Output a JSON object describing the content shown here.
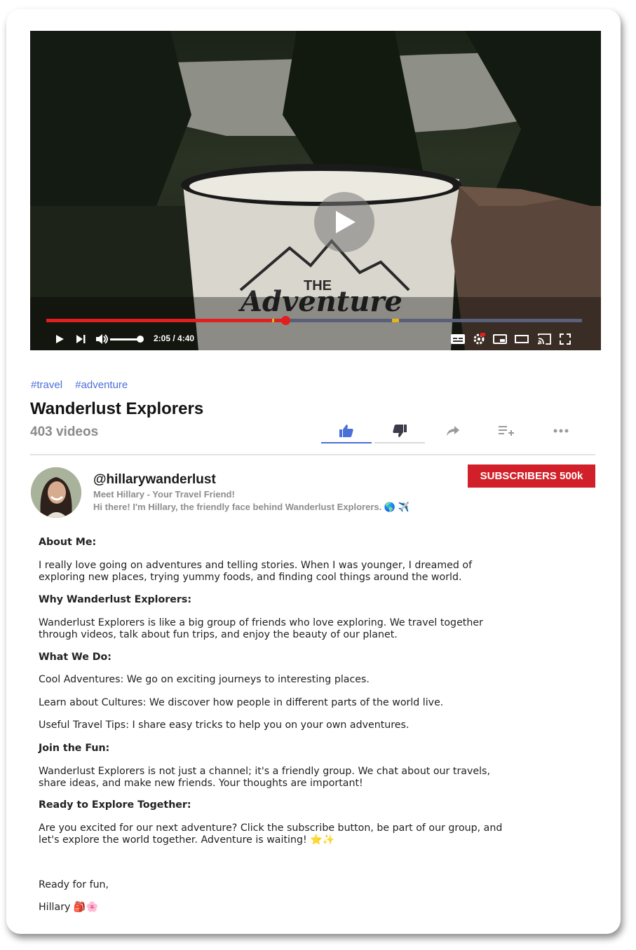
{
  "video": {
    "time_display": "2:05 / 4:40",
    "progress_fraction": 0.446,
    "mug_text_1": "THE",
    "mug_text_2": "Adventure"
  },
  "tags": [
    "#travel",
    "#adventure"
  ],
  "channel": {
    "title": "Wanderlust Explorers",
    "video_count": "403 videos",
    "handle": "@hillarywanderlust",
    "tagline": "Meet Hillary - Your Travel Friend!",
    "intro": "Hi there! I'm Hillary, the friendly face behind Wanderlust Explorers. 🌎 ✈️",
    "subscribers_label": "SUBSCRIBERS 500k"
  },
  "actions": [
    "like-icon",
    "dislike-icon",
    "share-icon",
    "add-to-playlist-icon",
    "more-icon"
  ],
  "colors": {
    "accent": "#d1202a",
    "link": "#4a6fd8",
    "like_active": "#4a6fd8",
    "progress": "#e01f1f"
  },
  "about": {
    "h1": "About Me:",
    "p1": "I really love going on adventures and telling stories. When I was younger, I dreamed of exploring new places, trying yummy foods, and finding cool things around the world.",
    "h2": "Why Wanderlust Explorers:",
    "p2": "Wanderlust Explorers is like a big group of friends who love exploring. We travel together through videos, talk about fun trips, and enjoy the beauty of our planet.",
    "h3": "What We Do:",
    "p3a": "Cool Adventures: We go on exciting journeys to interesting places.",
    "p3b": "Learn about Cultures: We discover how people in different parts of the world live.",
    "p3c": "Useful Travel Tips: I share easy tricks to help you on your own adventures.",
    "h4": "Join the Fun:",
    "p4": "Wanderlust Explorers is not just a channel; it's a friendly group. We chat about our travels, share ideas, and make new friends. Your thoughts are important!",
    "h5": "Ready to Explore Together:",
    "p5": "Are you excited for our next adventure? Click the subscribe button, be part of our group, and let's explore the world together. Adventure is waiting! ⭐✨",
    "closing": "Ready for fun,",
    "signature": "Hillary 🎒🌸"
  }
}
